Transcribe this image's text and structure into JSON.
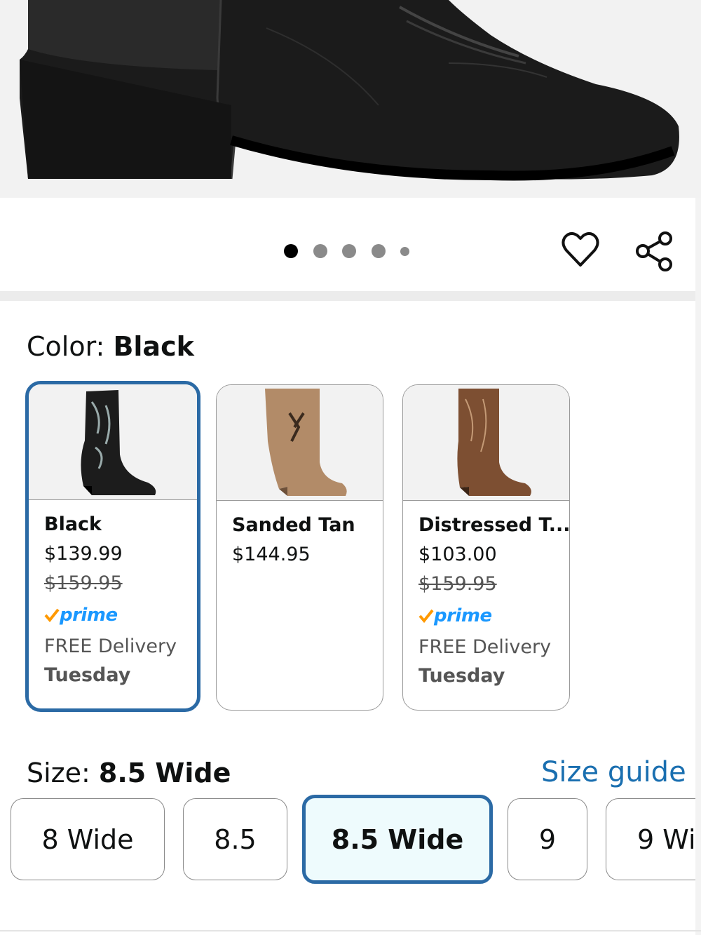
{
  "product_image": {
    "icon": "boot-photo"
  },
  "carousel": {
    "count": 5,
    "active_index": 0
  },
  "actions": {
    "wishlist_icon": "heart-icon",
    "share_icon": "share-icon"
  },
  "color": {
    "label": "Color: ",
    "selected": "Black",
    "options": [
      {
        "name": "Black",
        "price": "$139.99",
        "list_price": "$159.95",
        "prime": "prime",
        "delivery": "FREE Delivery",
        "day": "Tuesday",
        "selected": true
      },
      {
        "name": "Sanded Tan",
        "price": "$144.95",
        "selected": false
      },
      {
        "name": "Distressed T...",
        "price": "$103.00",
        "list_price": "$159.95",
        "prime": "prime",
        "delivery": "FREE Delivery",
        "day": "Tuesday",
        "selected": false
      }
    ]
  },
  "size": {
    "label": "Size: ",
    "selected": "8.5 Wide",
    "guide_link": "Size guide",
    "options": [
      "8 Wide",
      "8.5",
      "8.5 Wide",
      "9",
      "9 Wi"
    ]
  },
  "colors": {
    "accent": "#2b6aa5",
    "link": "#1a6fb0",
    "prime": "#1a98ff",
    "prime_check": "#ff9900"
  }
}
